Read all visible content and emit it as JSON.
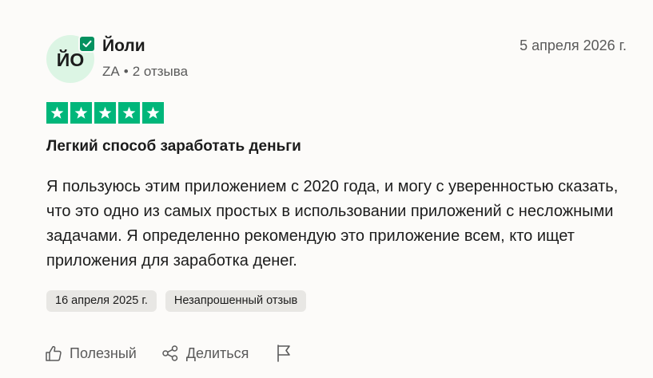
{
  "reviewer": {
    "initials": "ЙО",
    "name": "Йоли",
    "country": "ZA",
    "separator": "•",
    "reviews_count": "2 отзыва"
  },
  "review": {
    "date": "5 апреля 2026 г.",
    "rating": 5,
    "rating_max": 5,
    "title": "Легкий способ заработать деньги",
    "body": "Я пользуюсь этим приложением с 2020 года, и могу с уверенностью сказать, что это одно из самых простых в использовании приложений с несложными задачами. Я определенно рекомендую это приложение всем, кто ищет приложения для заработка денег."
  },
  "tags": {
    "experience_date": "16 апреля 2025 г.",
    "review_type": "Незапрошенный отзыв"
  },
  "actions": {
    "useful_label": "Полезный",
    "share_label": "Делиться"
  },
  "colors": {
    "star_green": "#00b67a",
    "verified_green": "#04915f",
    "avatar_bg": "#dcf5e4",
    "tag_bg": "#e8e7e4"
  }
}
